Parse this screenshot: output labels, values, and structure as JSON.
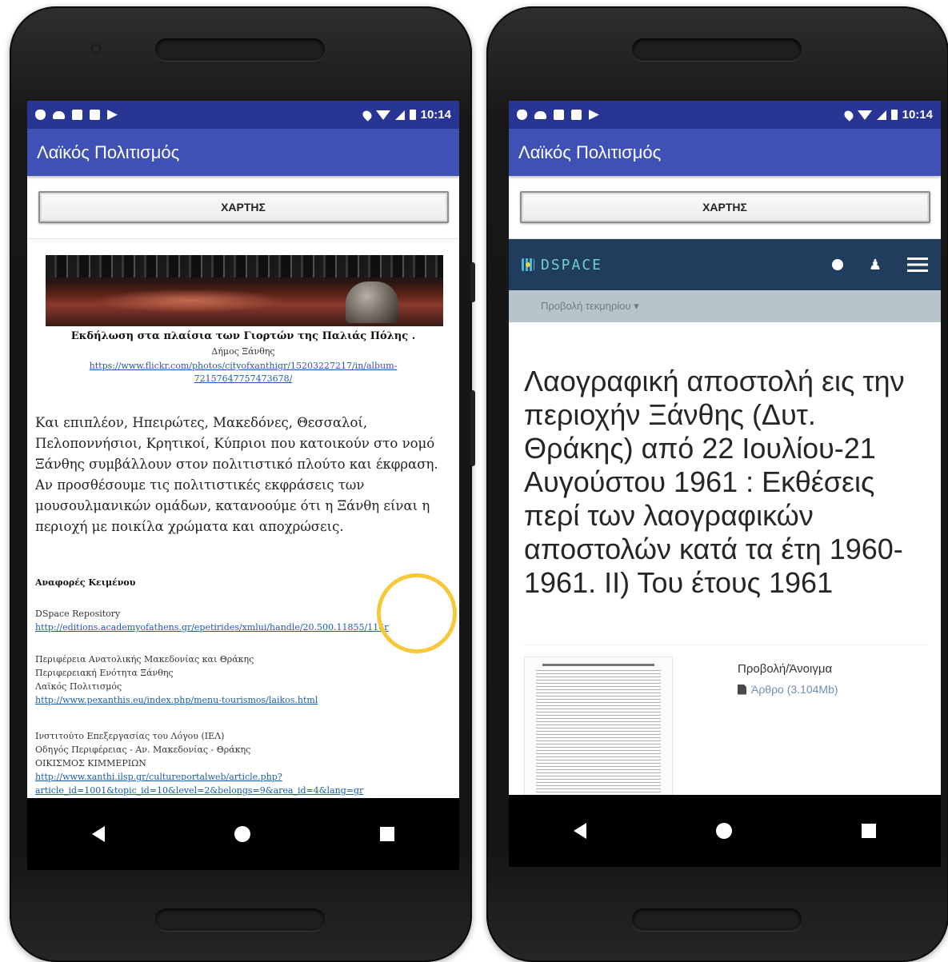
{
  "status_bar": {
    "time": "10:14"
  },
  "app": {
    "title": "Λαϊκός Πολιτισμός",
    "map_button": "ΧΑΡΤΗΣ"
  },
  "left": {
    "caption_title": "Εκδήλωση στα πλαίσια των Γιορτών της Παλιάς Πόλης .",
    "caption_author": "Δήμος Ξάνθης",
    "caption_link": "https://www.flickr.com/photos/cityofxanthigr/15203227217/in/album-72157647757473678/",
    "body": "Και επιπλέον, Ηπειρώτες, Μακεδόνες, Θεσσαλοί, Πελοποννήσιοι, Κρητικοί, Κύπριοι που κατοικούν στο νομό Ξάνθης συμβάλλουν στον πολιτιστικό πλούτο και έκφραση. Αν προσθέσουμε τις πολιτιστικές εκφράσεις των μουσουλμανικών ομάδων, κατανοούμε ότι η Ξάνθη είναι η περιοχή με ποικίλα χρώματα και αποχρώσεις.",
    "refs_heading": "Αναφορές Κειμένου",
    "ref1": {
      "name": "DSpace Repository",
      "link": "http://editions.academyofathens.gr/epetirides/xmlui/handle/20.500.11855/116r"
    },
    "ref2": {
      "line1": "Περιφέρεια Ανατολικής Μακεδονίας και Θράκης",
      "line2": "Περιφερειακή Ενότητα Ξάνθης",
      "line3": "Λαϊκός Πολιτισμός",
      "link": "http://www.pexanthis.eu/index.php/menu-tourismos/laikos.html"
    },
    "ref3": {
      "line1": "Ινστιτούτο Επεξεργασίας του Λόγου (ΙΕΛ)",
      "line2": "Οδηγός Περιφέρειας - Αν. Μακεδονίας - Θράκης",
      "line3": "ΟΙΚΙΣΜΟΣ ΚΙΜΜΕΡΙΩΝ",
      "link1": "http://www.xanthi.ilsp.gr/cultureportalweb/article.php?",
      "link2": "article_id=1001&topic_id=10&level=2&belongs=9&area_id=4&lang=gr"
    }
  },
  "right": {
    "dspace_logo": "DSPACE",
    "breadcrumb": "Προβολή τεκμηρίου ▾",
    "title": "Λαογραφική αποστολή εις την περιοχήν Ξάνθης (Δυτ. Θράκης) από 22 Ιουλίου-21 Αυγούστου 1961 : Εκθέσεις περί των λαογραφικών αποστολών κατά τα έτη 1960-1961. ΙΙ) Του έτους 1961",
    "view_open": "Προβολή/Άνοιγμα",
    "file": "Άρθρο (3.104Mb)"
  },
  "colors": {
    "status_bar": "#283593",
    "app_bar": "#3f51b5",
    "dspace_header": "#213d5e",
    "highlight": "#f7c93a",
    "link": "#1a5db0"
  }
}
